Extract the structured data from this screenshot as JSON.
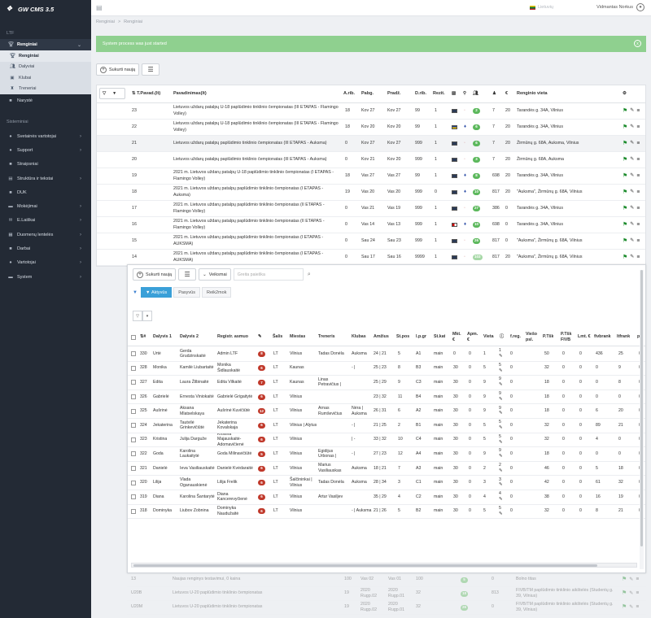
{
  "brand": {
    "title": "GW CMS 3.5"
  },
  "sidebar": {
    "section1": "LTF",
    "renginiai": "Renginiai",
    "sub": [
      {
        "label": "Renginiai"
      },
      {
        "label": "Dalyviai"
      },
      {
        "label": "Klubai"
      },
      {
        "label": "Treneriai"
      }
    ],
    "naryste": "Narystė",
    "section2": "Sisteminiai",
    "items": [
      {
        "label": "Svetainės vartotojai",
        "chev": true,
        "icon": "users-icon"
      },
      {
        "label": "Support",
        "chev": true,
        "icon": "support-icon"
      },
      {
        "label": "Straipsniai",
        "chev": false,
        "icon": "article-icon"
      },
      {
        "label": "Struktūra ir tekstai",
        "chev": true,
        "icon": "structure-icon"
      },
      {
        "label": "DUK",
        "chev": false,
        "icon": "faq-icon"
      },
      {
        "label": "Mokėjimai",
        "chev": true,
        "icon": "payment-icon"
      },
      {
        "label": "E.Laiškai",
        "chev": true,
        "icon": "mail-icon"
      },
      {
        "label": "Duomenų lentelės",
        "chev": true,
        "icon": "table-icon"
      },
      {
        "label": "Darbai",
        "chev": true,
        "icon": "tasks-icon"
      },
      {
        "label": "Vartotojai",
        "chev": true,
        "icon": "user-icon"
      },
      {
        "label": "System",
        "chev": true,
        "icon": "system-icon"
      }
    ]
  },
  "topbar": {
    "language": "Lietuvių",
    "user": "Vidmantas Norkus"
  },
  "breadcrumb": {
    "home": "Renginiai",
    "sep": ">",
    "current": "Renginiai"
  },
  "alert": {
    "text": "System process was just started",
    "close": "x"
  },
  "toolbar": {
    "create": "Sukurti naują"
  },
  "main": {
    "headers": {
      "id": "T.Pavad.(lt)",
      "title": "Pavadinimas(lt)",
      "arib": "A.rib.",
      "pabg": "Pabg.",
      "pradz": "Pradž.",
      "drib": "D.rib.",
      "rezit": "Rezit.",
      "venue": "Renginio vieta",
      "person": "",
      "euro": "€"
    },
    "rows": [
      {
        "id": "23",
        "title": "Lietuvos uždarų patalpų U-18 paplūdimio tinklinio čempionatas (III ETAPAS - Flamingo Volley)",
        "a": "18",
        "pabg": "Kov 27",
        "pradz": "Kov 27",
        "d": "99",
        "r": "1",
        "badge": "2",
        "bc": "bg-green",
        "n1": "7",
        "n2": "20",
        "venue": "Tarandės g. 34A, Vilnius",
        "fl": ""
      },
      {
        "id": "22",
        "title": "Lietuvos uždarų patalpų U-18 paplūdimio tinklinio čempionatas (III ETAPAS - Flamingo Volley)",
        "a": "18",
        "pabg": "Kov 20",
        "pradz": "Kov 20",
        "d": "99",
        "r": "1",
        "badge": "6",
        "bc": "bg-green",
        "n1": "7",
        "n2": "20",
        "venue": "Tarandės g. 34A, Vilnius",
        "fl": "yl"
      },
      {
        "id": "21",
        "title": "Lietuvos uždarų patalpų paplūdimio tinklinio čempionatas (III ETAPAS - Auksma)",
        "a": "0",
        "pabg": "Kov 27",
        "pradz": "Kov 27",
        "d": "999",
        "r": "1",
        "badge": "6",
        "bc": "bg-green",
        "n1": "7",
        "n2": "20",
        "venue": "Žirmūnų g. 68A, Auksma, Vilnius",
        "fl": ""
      },
      {
        "id": "20",
        "title": "Lietuvos uždarų patalpų paplūdimio tinklinio čempionatas (III ETAPAS - Auksma)",
        "a": "0",
        "pabg": "Kov 21",
        "pradz": "Kov 20",
        "d": "999",
        "r": "1",
        "badge": "3",
        "bc": "bg-green",
        "n1": "7",
        "n2": "20",
        "venue": "Žirmūnų g. 68A, Auksma",
        "fl": ""
      },
      {
        "id": "19",
        "title": "2021 m. Lietuvos uždarų patalpų U-18 paplūdimio tinklinio čempionatas (I ETAPAS - Flamingo Volley)",
        "a": "18",
        "pabg": "Vas 27",
        "pradz": "Vas 27",
        "d": "99",
        "r": "1",
        "badge": "8",
        "bc": "bg-green",
        "n1": "698",
        "n2": "20",
        "venue": "Tarandės g. 34A, Vilnius",
        "fl": ""
      },
      {
        "id": "18",
        "title": "2021 m. Lietuvos uždarų patalpų paplūdimio tinklinio čempionatas (I ETAPAS - Auksma)",
        "a": "19",
        "pabg": "Vas 20",
        "pradz": "Vas 20",
        "d": "999",
        "r": "0",
        "badge": "10",
        "bc": "bg-green",
        "n1": "817",
        "n2": "20",
        "venue": "\"Auksma\", Žirmūnų g. 68A, Vilnius",
        "fl": ""
      },
      {
        "id": "17",
        "title": "2021 m. Lietuvos uždarų patalpų paplūdimio tinklinio čempionatas (II ETAPAS - Flamingo Volley)",
        "a": "0",
        "pabg": "Vas 21",
        "pradz": "Vas 19",
        "d": "999",
        "r": "1",
        "badge": "27",
        "bc": "bg-green",
        "n1": "386",
        "n2": "0",
        "venue": "Tarandės g. 34A, Vilnius",
        "fl": ""
      },
      {
        "id": "16",
        "title": "2021 m. Lietuvos uždarų patalpų paplūdimio tinklinio čempionatas (II ETAPAS - Flamingo Volley)",
        "a": "0",
        "pabg": "Vas 14",
        "pradz": "Vas 13",
        "d": "999",
        "r": "1",
        "badge": "10",
        "bc": "bg-green",
        "n1": "698",
        "n2": "0",
        "venue": "Tarandės g. 34A, Vilnius",
        "fl": "rd"
      },
      {
        "id": "15",
        "title": "2021 m. Lietuvos uždarų patalpų paplūdimio tinklinio čempionatas (I ETAPAS - AUKSMA)",
        "a": "0",
        "pabg": "Sau 24",
        "pradz": "Sau 23",
        "d": "999",
        "r": "1",
        "badge": "26",
        "bc": "bg-green",
        "n1": "817",
        "n2": "0",
        "venue": "\"Auksma\", Žirmūnų g. 68A, Vilnius",
        "fl": ""
      },
      {
        "id": "14",
        "title": "2021 m. Lietuvos uždarų patalpų paplūdimio tinklinio čempionatas (I ETAPAS - AUKSMA)",
        "a": "0",
        "pabg": "Sau 17",
        "pradz": "Sau 16",
        "d": "9999",
        "r": "1",
        "badge": "103",
        "bc": "bg-lgreen",
        "n1": "817",
        "n2": "20",
        "venue": "\"Auksma\", Žirmūnų g. 68A, Vilnius",
        "fl": ""
      }
    ]
  },
  "sub": {
    "create": "Sukurti naują",
    "actions": "Veiksmai",
    "search_placeholder": "Greita paieška",
    "tabs": {
      "active": "Aktyvūs",
      "passive": "Pasyvūs",
      "reik": "Reik2mok"
    },
    "headers": {
      "nr": "#",
      "d1": "Dalyvis 1",
      "d2": "Dalyvis 2",
      "reg": "Registr. asmuo",
      "salis": "Šalis",
      "miestas": "Miestas",
      "treneris": "Treneris",
      "klubas": "Klubas",
      "amzius": "Amžius",
      "stpos": "St.pos",
      "lpgr": "l.p.gr",
      "stkat": "St.kat",
      "mkt": "Mkt. €",
      "apm": "Apm. €",
      "vieta": "Vieta",
      "freg": "f.reg.",
      "viespsl": "Viešo psl.",
      "ptsk": "P.Tšk",
      "ptskfivb": "P.Tšk FIVB",
      "lmt": "Lmt. €",
      "fivbrank": "fivbrank",
      "ltfrank": "ltfrank",
      "p": "p"
    },
    "rows": [
      {
        "nr": "330",
        "d1": "Urtė",
        "d2": "Gerda Grudzinskaitė",
        "reg": "Admin LTF",
        "b": "8",
        "salis": "LT",
        "miestas": "Vilnius",
        "treneris": "Tadas Donėla",
        "klubas": "Auksma",
        "amzius": "24 | 21",
        "stpos": "5",
        "lpgr": "A1",
        "stkat": "main",
        "mkt": "0",
        "apm": "0",
        "vieta": "1",
        "f": "1",
        "freg": "0",
        "ptsk": "50",
        "fivb": "0",
        "lmt": "0",
        "fivbrank": "436",
        "ltfrank": "25",
        "p": "0"
      },
      {
        "nr": "328",
        "d1": "Monika",
        "d2": "Kamilė Liubartaitė",
        "reg": "Monika Šidlauskaitė",
        "b": "6",
        "salis": "LT",
        "miestas": "Kaunas",
        "treneris": "",
        "klubas": "- |",
        "amzius": "25 | 23",
        "stpos": "8",
        "lpgr": "B3",
        "stkat": "main",
        "mkt": "30",
        "apm": "0",
        "vieta": "5",
        "f": "5",
        "freg": "0",
        "ptsk": "32",
        "fivb": "0",
        "lmt": "0",
        "fivbrank": "0",
        "ltfrank": "9",
        "p": "0"
      },
      {
        "nr": "327",
        "d1": "Edita",
        "d2": "Laura Žilbinaitė",
        "reg": "Edita Vilkaitė",
        "b": "7",
        "salis": "LT",
        "miestas": "Kaunas",
        "treneris": "Linas Petravičius |",
        "klubas": "",
        "amzius": "25 | 29",
        "stpos": "9",
        "lpgr": "C3",
        "stkat": "main",
        "mkt": "30",
        "apm": "0",
        "vieta": "9",
        "f": "9",
        "freg": "0",
        "ptsk": "18",
        "fivb": "0",
        "lmt": "0",
        "fivbrank": "0",
        "ltfrank": "8",
        "p": "0"
      },
      {
        "nr": "326",
        "d1": "Gabrielė",
        "d2": "Ernesta Viniokaitė",
        "reg": "Gabrielė Grigaitytė",
        "b": "6",
        "salis": "LT",
        "miestas": "Vilnius",
        "treneris": "",
        "klubas": "",
        "amzius": "23 | 32",
        "stpos": "11",
        "lpgr": "B4",
        "stkat": "main",
        "mkt": "30",
        "apm": "0",
        "vieta": "9",
        "f": "9",
        "freg": "0",
        "ptsk": "18",
        "fivb": "0",
        "lmt": "0",
        "fivbrank": "0",
        "ltfrank": "0",
        "p": "0"
      },
      {
        "nr": "325",
        "d1": "Aušrinė",
        "d2": "Aksana Mlatselskaya",
        "reg": "Aušrinė Kuvičiūtė",
        "b": "12",
        "salis": "LT",
        "miestas": "Vilnius",
        "treneris": "Arnas Rumševičius",
        "klubas": "Nėra | Auksma",
        "amzius": "26 | 31",
        "stpos": "6",
        "lpgr": "A2",
        "stkat": "main",
        "mkt": "30",
        "apm": "0",
        "vieta": "9",
        "f": "9",
        "freg": "0",
        "ptsk": "18",
        "fivb": "0",
        "lmt": "0",
        "fivbrank": "6",
        "ltfrank": "20",
        "p": "0"
      },
      {
        "nr": "324",
        "d1": "Jekaterina",
        "d2": "Tautvilė Grinkevičiūtė",
        "reg": "Jekaterina Kovalskaja",
        "b": "6",
        "salis": "LT",
        "miestas": "Vilnius | Alytus",
        "treneris": "",
        "klubas": "- |",
        "amzius": "21 | 25",
        "stpos": "2",
        "lpgr": "B1",
        "stkat": "main",
        "mkt": "30",
        "apm": "0",
        "vieta": "5",
        "f": "5",
        "freg": "0",
        "ptsk": "32",
        "fivb": "0",
        "lmt": "0",
        "fivbrank": "89",
        "ltfrank": "21",
        "p": "0"
      },
      {
        "nr": "323",
        "d1": "Kristina",
        "d2": "Julija Darguže",
        "reg": "Kristina Majauskaitė-Adomavičienė",
        "b": "6",
        "salis": "LT",
        "miestas": "Vilnius",
        "treneris": "",
        "klubas": "| -",
        "amzius": "33 | 32",
        "stpos": "10",
        "lpgr": "C4",
        "stkat": "main",
        "mkt": "30",
        "apm": "0",
        "vieta": "5",
        "f": "5",
        "freg": "0",
        "ptsk": "32",
        "fivb": "0",
        "lmt": "0",
        "fivbrank": "4",
        "ltfrank": "0",
        "p": "0"
      },
      {
        "nr": "322",
        "d1": "Goda",
        "d2": "Karolina Laukaitytė",
        "reg": "Goda Milinavičiūtė",
        "b": "5",
        "salis": "LT",
        "miestas": "Vilnius",
        "treneris": "Egidijus Urbonas |",
        "klubas": "- |",
        "amzius": "27 | 23",
        "stpos": "12",
        "lpgr": "A4",
        "stkat": "main",
        "mkt": "30",
        "apm": "0",
        "vieta": "9",
        "f": "9",
        "freg": "0",
        "ptsk": "18",
        "fivb": "0",
        "lmt": "0",
        "fivbrank": "0",
        "ltfrank": "0",
        "p": "0"
      },
      {
        "nr": "321",
        "d1": "Danielė",
        "d2": "Ieva Vasiliauskaitė",
        "reg": "Danielė Kvėdaraitė",
        "b": "6",
        "salis": "LT",
        "miestas": "Vilnius",
        "treneris": "Marius Vasiliauskas",
        "klubas": "Auksma",
        "amzius": "18 | 21",
        "stpos": "7",
        "lpgr": "A3",
        "stkat": "main",
        "mkt": "30",
        "apm": "0",
        "vieta": "2",
        "f": "2",
        "freg": "0",
        "ptsk": "46",
        "fivb": "0",
        "lmt": "0",
        "fivbrank": "5",
        "ltfrank": "18",
        "p": "0"
      },
      {
        "nr": "320",
        "d1": "Lilija",
        "d2": "Vlada Oganauskienė",
        "reg": "Lilija Frelik",
        "b": "6",
        "salis": "LT",
        "miestas": "Šalčininkai | Vilnius",
        "treneris": "Tadas Donėla",
        "klubas": "Auksma",
        "amzius": "28 | 34",
        "stpos": "3",
        "lpgr": "C1",
        "stkat": "main",
        "mkt": "30",
        "apm": "0",
        "vieta": "3",
        "f": "3",
        "freg": "0",
        "ptsk": "42",
        "fivb": "0",
        "lmt": "0",
        "fivbrank": "61",
        "ltfrank": "32",
        "p": "0"
      },
      {
        "nr": "319",
        "d1": "Diana",
        "d2": "Karolina Šantarytė",
        "reg": "Diana Kancerevyčienė",
        "b": "6",
        "salis": "LT",
        "miestas": "Vilnius",
        "treneris": "Artur Vasiljev",
        "klubas": "",
        "amzius": "35 | 29",
        "stpos": "4",
        "lpgr": "C2",
        "stkat": "main",
        "mkt": "30",
        "apm": "0",
        "vieta": "4",
        "f": "4",
        "freg": "0",
        "ptsk": "38",
        "fivb": "0",
        "lmt": "0",
        "fivbrank": "16",
        "ltfrank": "19",
        "p": "0"
      },
      {
        "nr": "318",
        "d1": "Dominyka",
        "d2": "Liubov Zobnina",
        "reg": "Dominyka Naudužaitė",
        "b": "6",
        "salis": "LT",
        "miestas": "Vilnius",
        "treneris": "",
        "klubas": "- | Auksma",
        "amzius": "21 | 26",
        "stpos": "5",
        "lpgr": "B2",
        "stkat": "main",
        "mkt": "30",
        "apm": "0",
        "vieta": "5",
        "f": "5",
        "freg": "0",
        "ptsk": "32",
        "fivb": "0",
        "lmt": "0",
        "fivbrank": "8",
        "ltfrank": "21",
        "p": "0"
      }
    ]
  },
  "faded": [
    {
      "id": "13",
      "title": "Naujas renginys testavimui, 0 kaina",
      "a": "100",
      "pabg": "Vas 02",
      "pradz": "Vas 01",
      "d": "100",
      "badge": "5",
      "n1": "0",
      "venue": "Bolno titas"
    },
    {
      "id": "U20B",
      "title": "Lietuvos U-20 paplūdimio tinklinio čempionatas",
      "a": "19",
      "pabg": "2020 Rugp.02",
      "pradz": "2020 Rugp.01",
      "d": "32",
      "badge": "18",
      "n1": "813",
      "venue": "FIVB/TM paplūdimio tinklinio aikštelės (Studentų g. 39, Vilnius)"
    },
    {
      "id": "U20M",
      "title": "Lietuvos U-20 paplūdimio tinklinio čempionatas",
      "a": "19",
      "pabg": "2020 Rugp.02",
      "pradz": "2020 Rugp.01",
      "d": "32",
      "badge": "26",
      "n1": "0",
      "venue": "FIVB/TM paplūdimio tinklinio aikštelės (Studentų g. 39, Vilnius)"
    }
  ]
}
